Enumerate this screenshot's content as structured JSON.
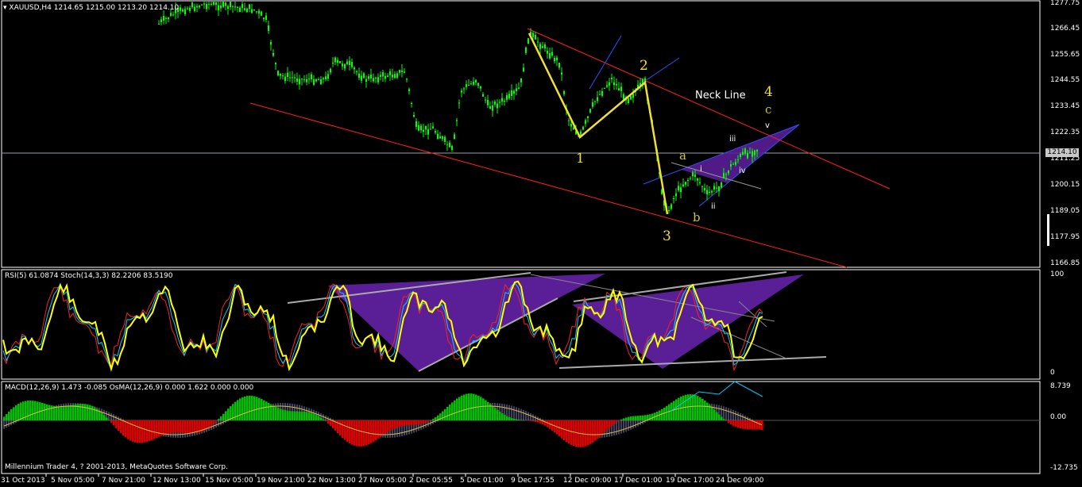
{
  "header": {
    "symbol_label": "XAUUSD,H4",
    "ohlc": "1214.65 1215.00 1213.20 1214.10",
    "rsi_stoch_label": "RSI(5) 61.0874  Stoch(14,3,3) 82.2206 83.5190",
    "macd_label": "MACD(12,26,9) 1.473 -0.085  OsMA(12,26,9) 0.000 1.622 0.000 0.000"
  },
  "price_axis": {
    "ticks": [
      "1277.75",
      "1266.45",
      "1255.65",
      "1244.55",
      "1233.45",
      "1222.35",
      "1211.25",
      "1200.15",
      "1189.05",
      "1177.95",
      "1166.85"
    ],
    "current": "1214.10"
  },
  "indicator_axis": {
    "rsi_max": "100",
    "rsi_min": "0",
    "macd_max": "8.739",
    "macd_zero": "0.00",
    "macd_min": "-12.735"
  },
  "time_axis": {
    "ticks": [
      "31 Oct 2013",
      "5 Nov 05:00",
      "7 Nov 21:00",
      "12 Nov 13:00",
      "15 Nov 05:00",
      "19 Nov 21:00",
      "22 Nov 13:00",
      "27 Nov 05:00",
      "2 Dec 05:55",
      "5 Dec 01:00",
      "9 Dec 17:55",
      "12 Dec 09:00",
      "17 Dec 01:00",
      "19 Dec 17:00",
      "24 Dec 09:00"
    ]
  },
  "annotations": {
    "neck_line": "Neck Line",
    "w1": "1",
    "w2": "2",
    "w3": "3",
    "w4": "4",
    "wa": "a",
    "wb": "b",
    "wc": "c",
    "si": "i",
    "sii": "ii",
    "siii": "iii",
    "siv": "iv",
    "sv": "v"
  },
  "copyright": "Millennium Trader 4, ? 2001-2013, MetaQuotes Software Corp.",
  "colors": {
    "candle": "#00ff00",
    "wave": "#f0e030",
    "trend": "#ff2020",
    "wedge": "#5a1e96",
    "macd_up": "#00c000",
    "macd_down": "#e00000"
  }
}
